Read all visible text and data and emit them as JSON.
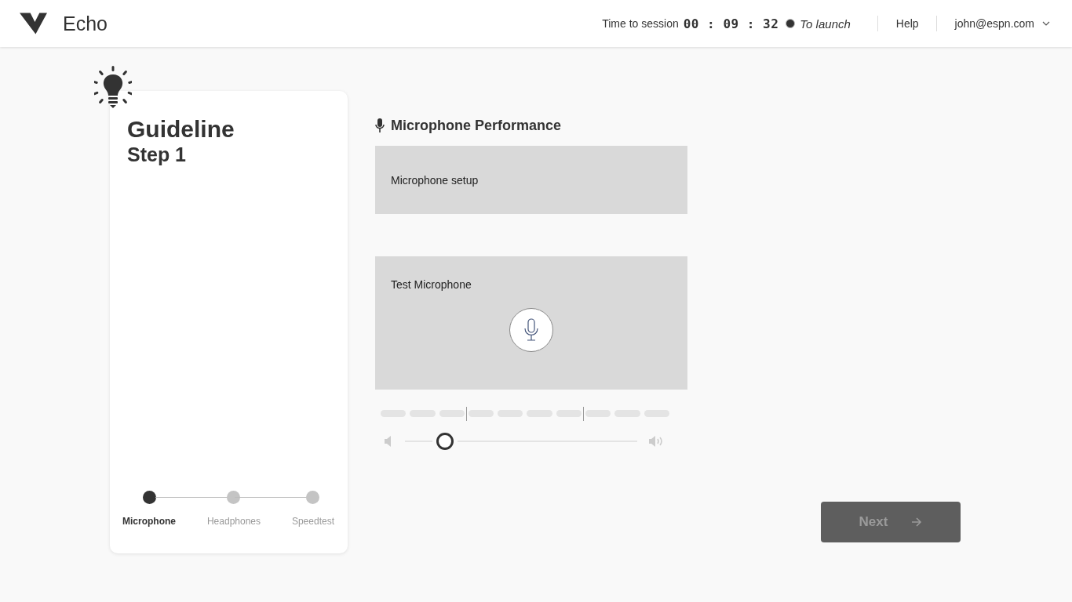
{
  "header": {
    "app_name": "Echo",
    "session_label": "Time to session",
    "timer": "00 : 09 : 32",
    "status": "To launch",
    "help": "Help",
    "user": "john@espn.com"
  },
  "guideline": {
    "title": "Guideline",
    "subtitle": "Step 1",
    "steps": [
      {
        "label": "Microphone",
        "selected": true
      },
      {
        "label": "Headphones",
        "selected": false
      },
      {
        "label": "Speedtest",
        "selected": false
      }
    ]
  },
  "panel": {
    "title": "Microphone Performance",
    "setup_label": "Microphone setup",
    "test_label": "Test Microphone",
    "volume": {
      "level": 0.17
    }
  },
  "next_button": {
    "label": "Next",
    "disabled": true
  }
}
